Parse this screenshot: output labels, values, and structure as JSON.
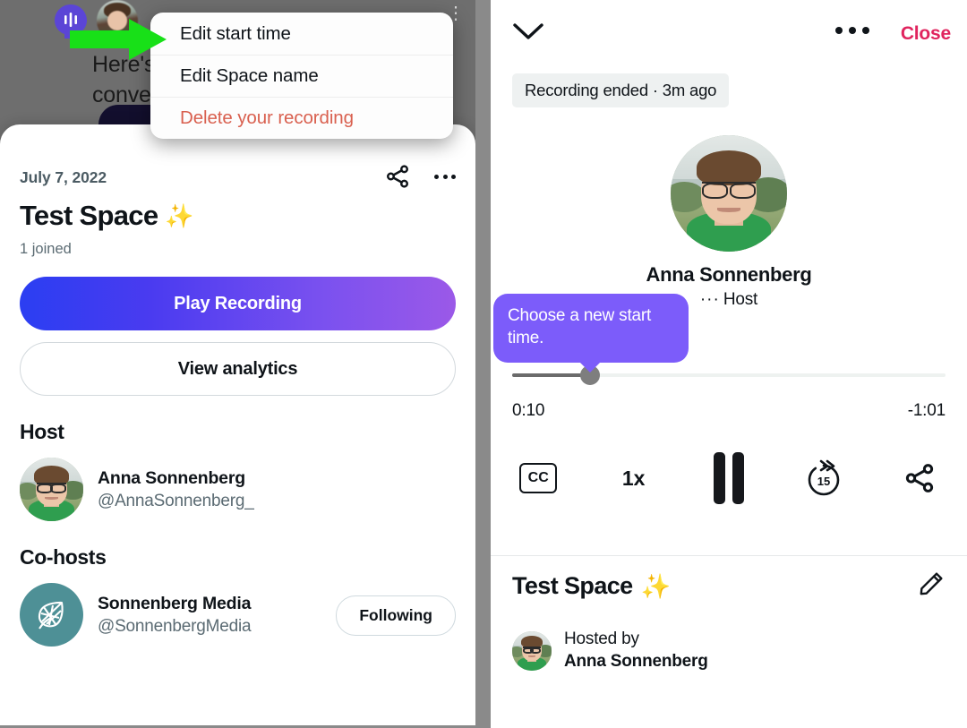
{
  "left_panel": {
    "background": {
      "space_icon": "spaces-microphone-icon",
      "text_line_1": "Here's",
      "text_line_2": "conver"
    },
    "menu": {
      "items": [
        {
          "label": "Edit start time",
          "style": "default"
        },
        {
          "label": "Edit Space name",
          "style": "default"
        },
        {
          "label": "Delete your recording",
          "style": "danger"
        }
      ]
    },
    "annotation": {
      "arrow_color": "#18e018",
      "points_to": "Edit start time"
    },
    "card": {
      "date": "July 7, 2022",
      "title": "Test Space",
      "title_emoji": "✨",
      "joined": "1 joined",
      "share_icon": "share-icon",
      "more_icon": "more-options-icon",
      "play_button": "Play Recording",
      "analytics_button": "View analytics",
      "host_section_label": "Host",
      "host": {
        "name": "Anna Sonnenberg",
        "handle": "@AnnaSonnenberg_",
        "avatar": "anna-photo-avatar"
      },
      "cohosts_section_label": "Co-hosts",
      "cohosts": [
        {
          "name": "Sonnenberg Media",
          "handle": "@SonnenbergMedia",
          "avatar": "sonnenberg-media-leaf-logo",
          "follow_label": "Following"
        }
      ]
    }
  },
  "right_panel": {
    "header": {
      "collapse_icon": "chevron-down-icon",
      "more_icon": "more-options-icon",
      "close_label": "Close"
    },
    "status_pill": "Recording ended · 3m ago",
    "speaker": {
      "avatar": "anna-photo-avatar",
      "name": "Anna Sonnenberg",
      "role": "Host",
      "mic_indicator": "···"
    },
    "tooltip": {
      "text": "Choose a new start time.",
      "color": "#7c5cfa"
    },
    "player": {
      "elapsed": "0:10",
      "remaining": "-1:01",
      "progress_percent": 18,
      "controls": {
        "captions": "CC",
        "captions_icon": "closed-captions-icon",
        "speed": "1x",
        "playback_state_icon": "pause-icon",
        "skip_forward_icon": "forward-15-icon",
        "skip_forward_label": "15",
        "share_icon": "share-icon"
      }
    },
    "space_info": {
      "title": "Test Space",
      "title_emoji": "✨",
      "edit_icon": "pencil-edit-icon",
      "hosted_by_label": "Hosted by",
      "host_name": "Anna Sonnenberg",
      "host_avatar": "anna-photo-avatar"
    }
  }
}
